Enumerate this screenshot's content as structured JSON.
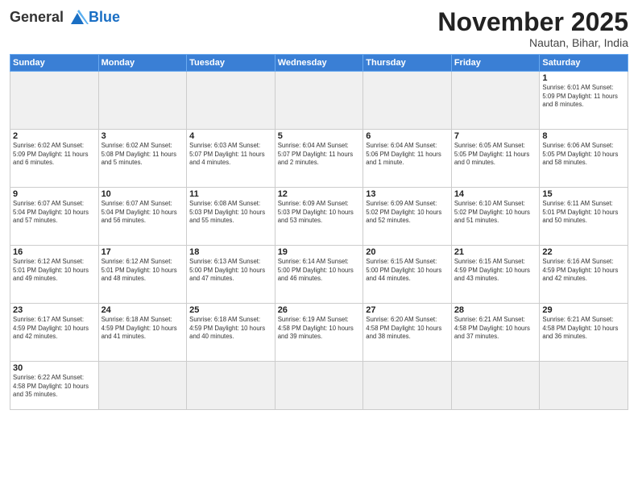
{
  "header": {
    "logo_general": "General",
    "logo_blue": "Blue",
    "logo_subtitle": "Blue",
    "month_title": "November 2025",
    "location": "Nautan, Bihar, India"
  },
  "days_of_week": [
    "Sunday",
    "Monday",
    "Tuesday",
    "Wednesday",
    "Thursday",
    "Friday",
    "Saturday"
  ],
  "weeks": [
    [
      {
        "day": "",
        "empty": true
      },
      {
        "day": "",
        "empty": true
      },
      {
        "day": "",
        "empty": true
      },
      {
        "day": "",
        "empty": true
      },
      {
        "day": "",
        "empty": true
      },
      {
        "day": "",
        "empty": true
      },
      {
        "day": "1",
        "info": "Sunrise: 6:01 AM\nSunset: 5:09 PM\nDaylight: 11 hours\nand 8 minutes."
      }
    ],
    [
      {
        "day": "2",
        "info": "Sunrise: 6:02 AM\nSunset: 5:09 PM\nDaylight: 11 hours\nand 6 minutes."
      },
      {
        "day": "3",
        "info": "Sunrise: 6:02 AM\nSunset: 5:08 PM\nDaylight: 11 hours\nand 5 minutes."
      },
      {
        "day": "4",
        "info": "Sunrise: 6:03 AM\nSunset: 5:07 PM\nDaylight: 11 hours\nand 4 minutes."
      },
      {
        "day": "5",
        "info": "Sunrise: 6:04 AM\nSunset: 5:07 PM\nDaylight: 11 hours\nand 2 minutes."
      },
      {
        "day": "6",
        "info": "Sunrise: 6:04 AM\nSunset: 5:06 PM\nDaylight: 11 hours\nand 1 minute."
      },
      {
        "day": "7",
        "info": "Sunrise: 6:05 AM\nSunset: 5:05 PM\nDaylight: 11 hours\nand 0 minutes."
      },
      {
        "day": "8",
        "info": "Sunrise: 6:06 AM\nSunset: 5:05 PM\nDaylight: 10 hours\nand 58 minutes."
      }
    ],
    [
      {
        "day": "9",
        "info": "Sunrise: 6:07 AM\nSunset: 5:04 PM\nDaylight: 10 hours\nand 57 minutes."
      },
      {
        "day": "10",
        "info": "Sunrise: 6:07 AM\nSunset: 5:04 PM\nDaylight: 10 hours\nand 56 minutes."
      },
      {
        "day": "11",
        "info": "Sunrise: 6:08 AM\nSunset: 5:03 PM\nDaylight: 10 hours\nand 55 minutes."
      },
      {
        "day": "12",
        "info": "Sunrise: 6:09 AM\nSunset: 5:03 PM\nDaylight: 10 hours\nand 53 minutes."
      },
      {
        "day": "13",
        "info": "Sunrise: 6:09 AM\nSunset: 5:02 PM\nDaylight: 10 hours\nand 52 minutes."
      },
      {
        "day": "14",
        "info": "Sunrise: 6:10 AM\nSunset: 5:02 PM\nDaylight: 10 hours\nand 51 minutes."
      },
      {
        "day": "15",
        "info": "Sunrise: 6:11 AM\nSunset: 5:01 PM\nDaylight: 10 hours\nand 50 minutes."
      }
    ],
    [
      {
        "day": "16",
        "info": "Sunrise: 6:12 AM\nSunset: 5:01 PM\nDaylight: 10 hours\nand 49 minutes."
      },
      {
        "day": "17",
        "info": "Sunrise: 6:12 AM\nSunset: 5:01 PM\nDaylight: 10 hours\nand 48 minutes."
      },
      {
        "day": "18",
        "info": "Sunrise: 6:13 AM\nSunset: 5:00 PM\nDaylight: 10 hours\nand 47 minutes."
      },
      {
        "day": "19",
        "info": "Sunrise: 6:14 AM\nSunset: 5:00 PM\nDaylight: 10 hours\nand 46 minutes."
      },
      {
        "day": "20",
        "info": "Sunrise: 6:15 AM\nSunset: 5:00 PM\nDaylight: 10 hours\nand 44 minutes."
      },
      {
        "day": "21",
        "info": "Sunrise: 6:15 AM\nSunset: 4:59 PM\nDaylight: 10 hours\nand 43 minutes."
      },
      {
        "day": "22",
        "info": "Sunrise: 6:16 AM\nSunset: 4:59 PM\nDaylight: 10 hours\nand 42 minutes."
      }
    ],
    [
      {
        "day": "23",
        "info": "Sunrise: 6:17 AM\nSunset: 4:59 PM\nDaylight: 10 hours\nand 42 minutes."
      },
      {
        "day": "24",
        "info": "Sunrise: 6:18 AM\nSunset: 4:59 PM\nDaylight: 10 hours\nand 41 minutes."
      },
      {
        "day": "25",
        "info": "Sunrise: 6:18 AM\nSunset: 4:59 PM\nDaylight: 10 hours\nand 40 minutes."
      },
      {
        "day": "26",
        "info": "Sunrise: 6:19 AM\nSunset: 4:58 PM\nDaylight: 10 hours\nand 39 minutes."
      },
      {
        "day": "27",
        "info": "Sunrise: 6:20 AM\nSunset: 4:58 PM\nDaylight: 10 hours\nand 38 minutes."
      },
      {
        "day": "28",
        "info": "Sunrise: 6:21 AM\nSunset: 4:58 PM\nDaylight: 10 hours\nand 37 minutes."
      },
      {
        "day": "29",
        "info": "Sunrise: 6:21 AM\nSunset: 4:58 PM\nDaylight: 10 hours\nand 36 minutes."
      }
    ],
    [
      {
        "day": "30",
        "info": "Sunrise: 6:22 AM\nSunset: 4:58 PM\nDaylight: 10 hours\nand 35 minutes."
      },
      {
        "day": "",
        "empty": true
      },
      {
        "day": "",
        "empty": true
      },
      {
        "day": "",
        "empty": true
      },
      {
        "day": "",
        "empty": true
      },
      {
        "day": "",
        "empty": true
      },
      {
        "day": "",
        "empty": true
      }
    ]
  ]
}
